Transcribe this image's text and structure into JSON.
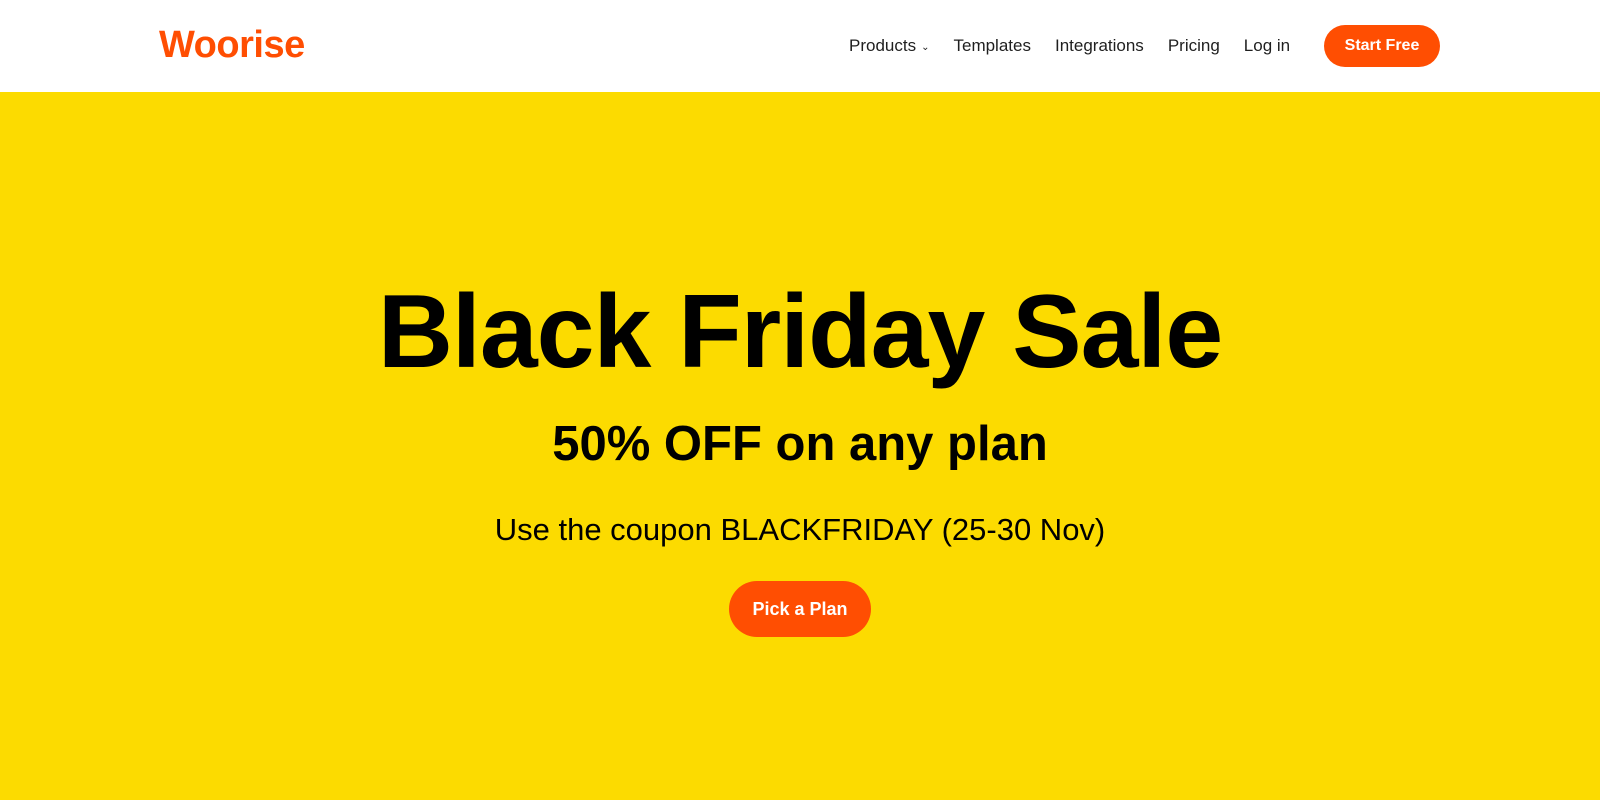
{
  "brand": {
    "logo_text": "Woorise",
    "accent_color": "#FF4E02",
    "hero_background": "#FCDB00"
  },
  "nav": {
    "items": [
      {
        "label": "Products",
        "icon": "chevron-down-icon"
      },
      {
        "label": "Templates"
      },
      {
        "label": "Integrations"
      },
      {
        "label": "Pricing"
      },
      {
        "label": "Log in"
      }
    ],
    "cta_label": "Start Free"
  },
  "hero": {
    "title": "Black Friday Sale",
    "subtitle": "50% OFF on any plan",
    "coupon_text": "Use the coupon BLACKFRIDAY (25-30 Nov)",
    "cta_label": "Pick a Plan"
  }
}
